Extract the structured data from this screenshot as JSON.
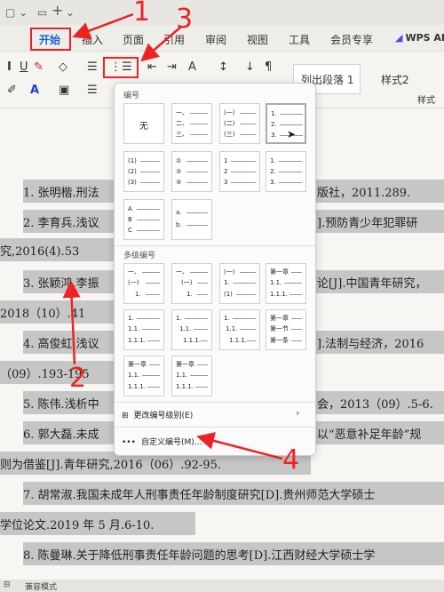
{
  "menu": {
    "tabs": [
      "开始",
      "插入",
      "页面",
      "引用",
      "审阅",
      "视图",
      "工具",
      "会员专享"
    ],
    "active": "开始",
    "ai": "WPS AI"
  },
  "styles": {
    "style1": "列出段落 1",
    "style2": "样式2",
    "group_label": "样式"
  },
  "dropdown": {
    "title_numbering": "编号",
    "none_label": "无",
    "title_multilevel": "多级编号",
    "change_level": "更改编号级别(E)",
    "custom": "自定义编号(M)..."
  },
  "document": {
    "lines": [
      "1.  张明楷.刑法",
      "2.  李育兵.浅议",
      "究,2016(4).53",
      "3.  张颖鸿,李振",
      "2018（10）.41",
      "4.  高俊虹.浅议",
      "（09）.193-195",
      "5.  陈伟.浅析中",
      "6.  郭大磊.未成",
      "则为借鉴[J].青年研究,2016（06）.92-95.",
      "7.  胡常淑.我国未成年人刑事责任年龄制度研究[D].贵州师范大学硕士",
      "学位论文.2019 年 5 月.6-10.",
      "8.  陈曼琳.关于降低刑事责任年龄问题的思考[D].江西财经大学硕士学"
    ],
    "right_tails": [
      "版社，2011.289.",
      "].预防青少年犯罪研",
      "",
      "论[J].中国青年研究，",
      "",
      "].法制与经济，2016",
      "",
      "会，2013（09）.5-6.",
      "以“恶意补足年龄”规"
    ]
  },
  "status": {
    "mode": "兼容模式"
  },
  "annotations": [
    "1",
    "2",
    "3",
    "4"
  ],
  "colors": {
    "accent": "#1a5fd6",
    "annotation": "#e22222",
    "highlight": "#c6c6c6"
  }
}
